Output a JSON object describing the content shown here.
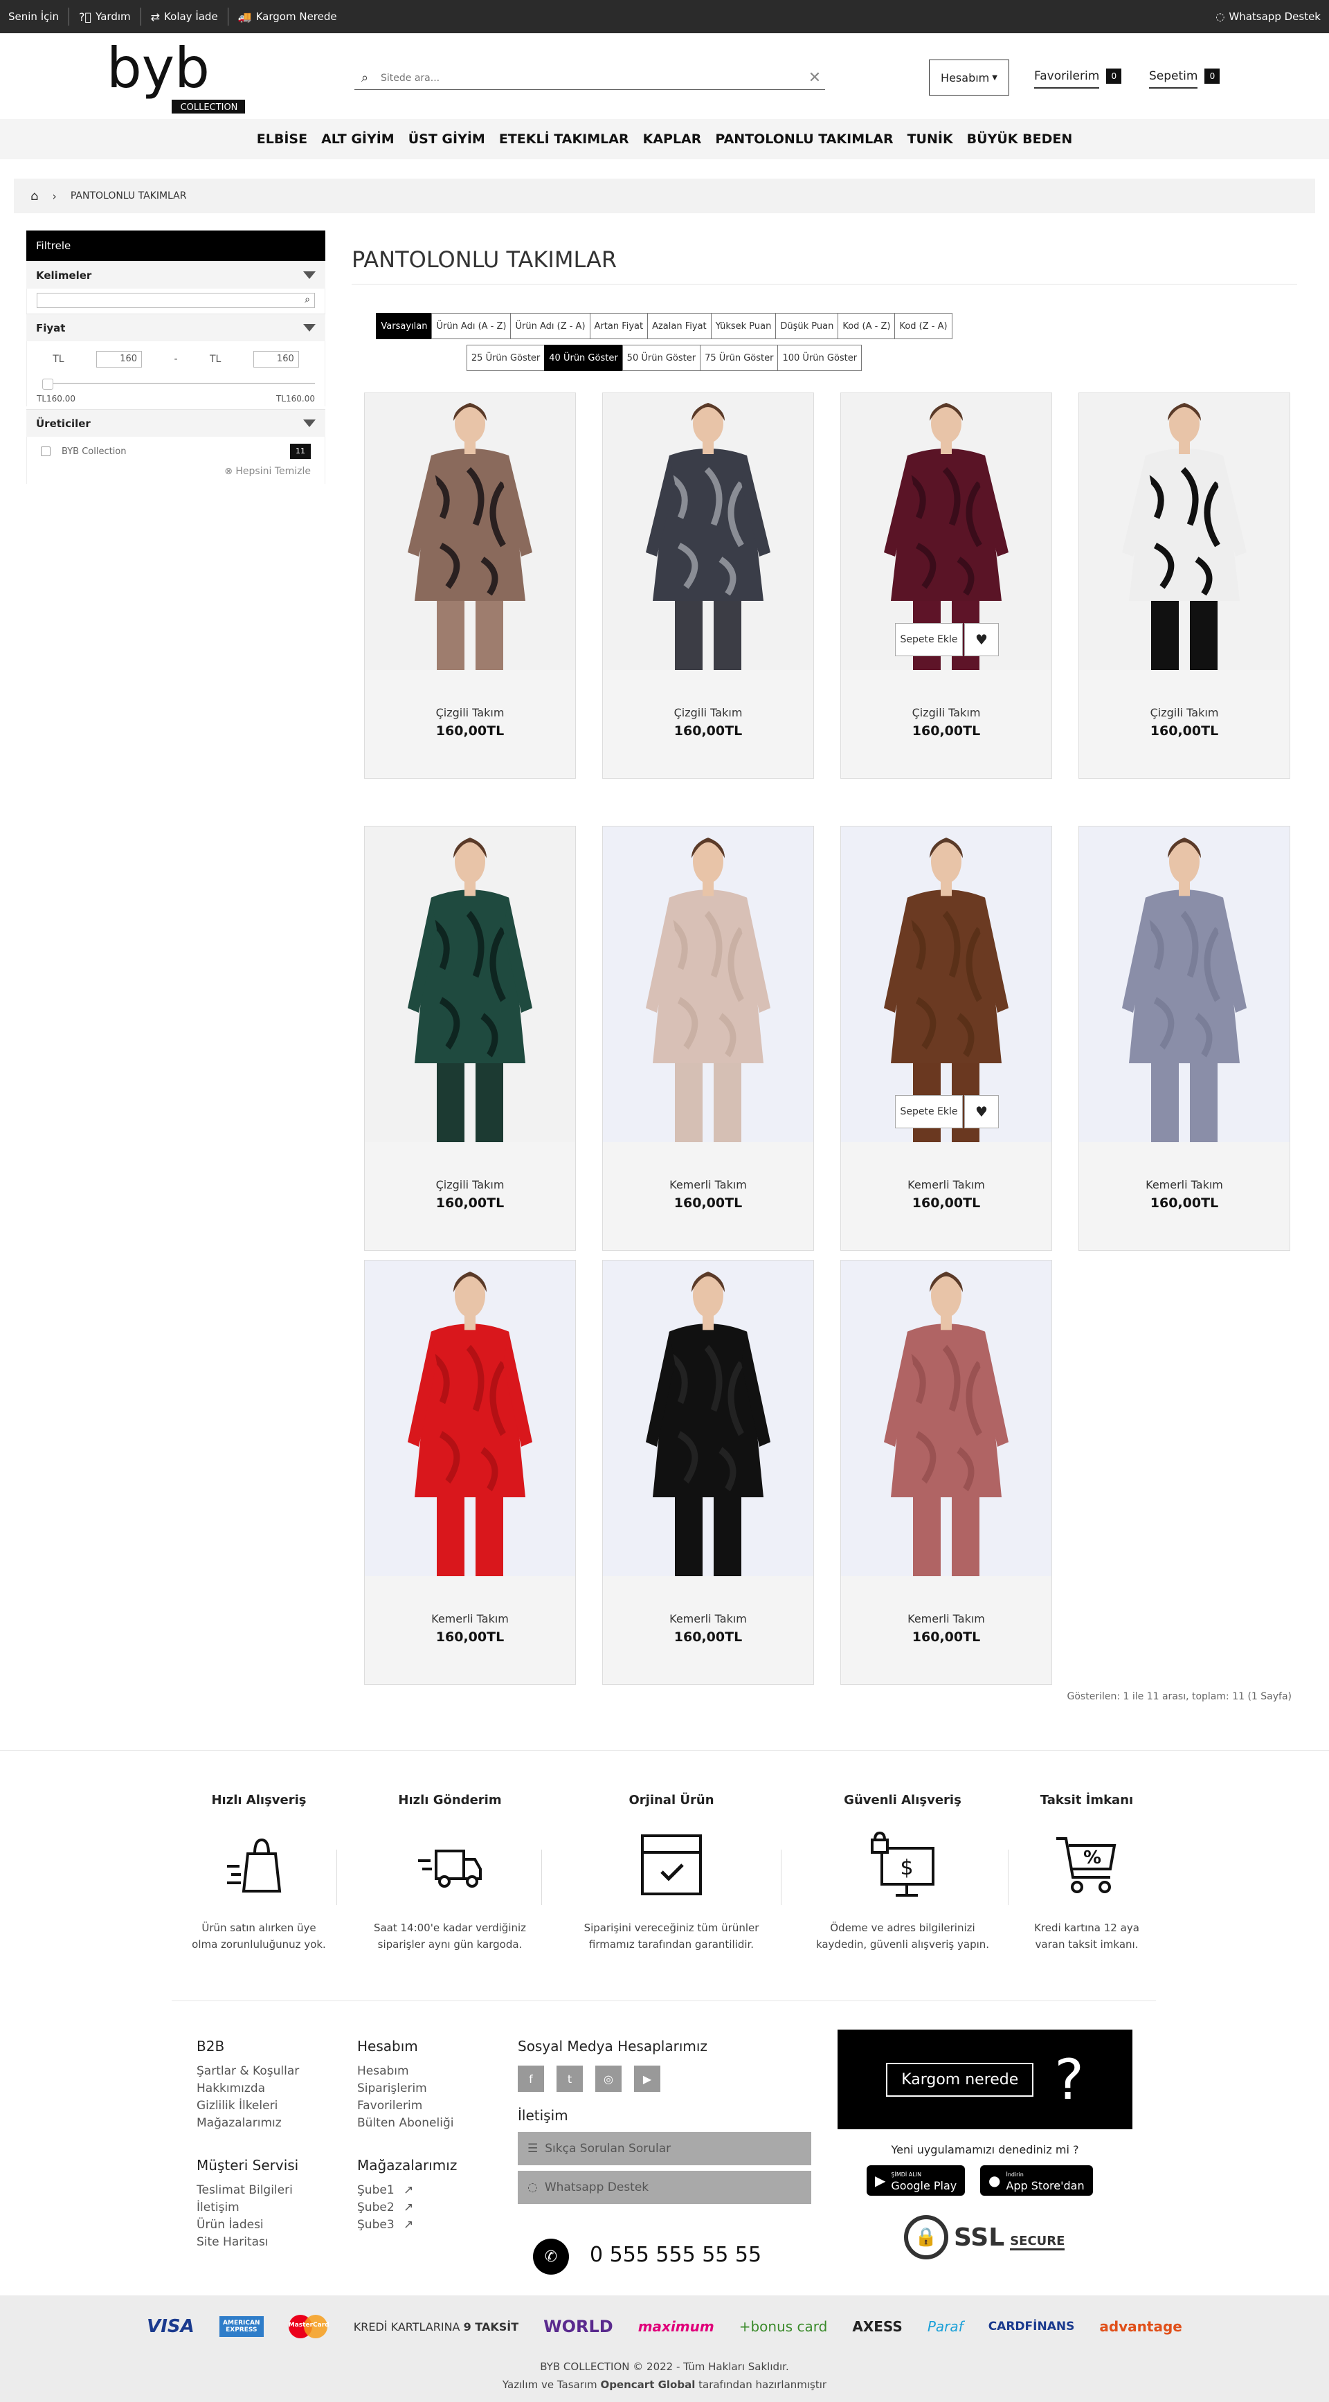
{
  "topbar": {
    "senin_icin": "Senin İçin",
    "yardim": "Yardım",
    "kolay_iade": "Kolay İade",
    "kargom_nerede": "Kargom Nerede",
    "whatsapp": "Whatsapp Destek"
  },
  "header": {
    "logo_main": "byb",
    "logo_sub": "COLLECTION",
    "search_placeholder": "Sitede ara...",
    "account": "Hesabım",
    "favorites": "Favorilerim",
    "favorites_count": "0",
    "cart": "Sepetim",
    "cart_count": "0"
  },
  "menu": [
    "ELBİSE",
    "ALT GİYİM",
    "ÜST GİYİM",
    "ETEKLİ TAKIMLAR",
    "KAPLAR",
    "PANTOLONLU TAKIMLAR",
    "TUNİK",
    "BÜYÜK BEDEN"
  ],
  "breadcrumb": {
    "current": "PANTOLONLU TAKIMLAR"
  },
  "sidebar": {
    "title": "Filtrele",
    "keywords": "Kelimeler",
    "price": "Fiyat",
    "price_cur": "TL",
    "price_min": "160",
    "price_max": "160",
    "price_sep": "-",
    "range_min": "TL160.00",
    "range_max": "TL160.00",
    "manufacturers": "Üreticiler",
    "manufacturer_name": "BYB Collection",
    "manufacturer_count": "11",
    "clear_all": "Hepsini Temizle"
  },
  "page_title": "PANTOLONLU TAKIMLAR",
  "sort_options": [
    "Varsayılan",
    "Ürün Adı (A - Z)",
    "Ürün Adı (Z - A)",
    "Artan Fiyat",
    "Azalan Fiyat",
    "Yüksek Puan",
    "Düşük Puan",
    "Kod (A - Z)",
    "Kod (Z - A)"
  ],
  "sort_active": 0,
  "limit_options": [
    "25 Ürün Göster",
    "40 Ürün Göster",
    "50 Ürün Göster",
    "75 Ürün Göster",
    "100 Ürün Göster"
  ],
  "limit_active": 1,
  "add_to_cart": "Sepete Ekle",
  "products": [
    {
      "name": "Çizgili Takım",
      "price": "160,00TL",
      "top": "#8a6a5c",
      "pattern": "#2a2020",
      "bottom": "#9e7d6e",
      "bg": "#f2f2f2"
    },
    {
      "name": "Çizgili Takım",
      "price": "160,00TL",
      "top": "#3a3d48",
      "pattern": "#8a8d95",
      "bottom": "#3c3d45",
      "bg": "#f2f2f2"
    },
    {
      "name": "Çizgili Takım",
      "price": "160,00TL",
      "top": "#5a1426",
      "pattern": "#3a0c1a",
      "bottom": "#5e1428",
      "bg": "#f2f2f2"
    },
    {
      "name": "Çizgili Takım",
      "price": "160,00TL",
      "top": "#eeeeee",
      "pattern": "#111111",
      "bottom": "#111111",
      "bg": "#f2f2f2"
    },
    {
      "name": "Çizgili Takım",
      "price": "160,00TL",
      "top": "#1f4a3f",
      "pattern": "#0e2520",
      "bottom": "#1c3a32",
      "bg": "#f2f2f2"
    },
    {
      "name": "Kemerli Takım",
      "price": "160,00TL",
      "top": "#d8c0b6",
      "pattern": "#c9b0a4",
      "bottom": "#d5bfb4",
      "bg": "#eef0f8"
    },
    {
      "name": "Kemerli Takım",
      "price": "160,00TL",
      "top": "#6b3a22",
      "pattern": "#5a3018",
      "bottom": "#6a3820",
      "bg": "#eef0f8"
    },
    {
      "name": "Kemerli Takım",
      "price": "160,00TL",
      "top": "#8a8ea8",
      "pattern": "#7a7e98",
      "bottom": "#8a8ea8",
      "bg": "#eef0f8"
    },
    {
      "name": "Kemerli Takım",
      "price": "160,00TL",
      "top": "#d9171c",
      "pattern": "#b41014",
      "bottom": "#d9171c",
      "bg": "#eef0f8"
    },
    {
      "name": "Kemerli Takım",
      "price": "160,00TL",
      "top": "#111111",
      "pattern": "#222222",
      "bottom": "#111111",
      "bg": "#eef0f8"
    },
    {
      "name": "Kemerli Takım",
      "price": "160,00TL",
      "top": "#b06464",
      "pattern": "#9a5252",
      "bottom": "#b06464",
      "bg": "#eef0f8"
    }
  ],
  "shown_text": "Gösterilen: 1 ile 11 arası, toplam: 11 (1 Sayfa)",
  "features": [
    {
      "title": "Hızlı Alışveriş",
      "desc1": "Ürün satın alırken üye",
      "desc2": "olma zorunluluğunuz yok.",
      "icon": "shopping-bag-icon"
    },
    {
      "title": "Hızlı Gönderim",
      "desc1": "Saat 14:00'e kadar verdiğiniz",
      "desc2": "siparişler aynı gün kargoda.",
      "icon": "truck-icon"
    },
    {
      "title": "Orjinal Ürün",
      "desc1": "Siparişini vereceğiniz tüm ürünler",
      "desc2": "firmamız tarafından garantilidir.",
      "icon": "box-check-icon"
    },
    {
      "title": "Güvenli Alışveriş",
      "desc1": "Ödeme ve adres bilgilerinizi",
      "desc2": "kaydedin, güvenli alışveriş yapın.",
      "icon": "secure-monitor-icon"
    },
    {
      "title": "Taksit İmkanı",
      "desc1": "Kredi kartına 12 aya",
      "desc2": "varan taksit imkanı.",
      "icon": "percent-cart-icon"
    }
  ],
  "footer": {
    "b2b_title": "B2B",
    "b2b_links": [
      "Şartlar & Koşullar",
      "Hakkımızda",
      "Gizlilik İlkeleri",
      "Mağazalarımız"
    ],
    "account_title": "Hesabım",
    "account_links": [
      "Hesabım",
      "Siparişlerim",
      "Favorilerim",
      "Bülten Aboneliği"
    ],
    "customer_title": "Müşteri Servisi",
    "customer_links": [
      "Teslimat Bilgileri",
      "İletişim",
      "Ürün İadesi",
      "Site Haritası"
    ],
    "stores_title": "Mağazalarımız",
    "stores_links": [
      "Şube1",
      "Şube2",
      "Şube3"
    ],
    "social_title": "Sosyal Medya Hesaplarımız",
    "contact_title": "İletişim",
    "faq": "Sıkça Sorulan Sorular",
    "whatsapp": "Whatsapp Destek",
    "phone": "0 555 555 55 55",
    "kargom": "Kargom nerede",
    "kargom_q": "?",
    "app_question": "Yeni uygulamamızı denediniz mi ?",
    "google_play_small": "ŞİMDİ ALIN",
    "google_play": "Google Play",
    "app_store_small": "İndirin",
    "app_store": "App Store'dan",
    "ssl": "SSL",
    "ssl_secure": "SECURE"
  },
  "payments": [
    "VISA",
    "AMERICAN EXPRESS",
    "MasterCard",
    "KREDİ KARTLARINA",
    "9 TAKSİT",
    "WORLD",
    "maximum",
    "+bonus card",
    "AXESS",
    "Paraf",
    "CARDFİNANS",
    "advantage"
  ],
  "copyright": "BYB COLLECTION © 2022 - Tüm Hakları Saklıdır.",
  "credit_prefix": "Yazılım ve Tasarım",
  "credit_brand": "Opencart Global",
  "credit_suffix": "tarafından hazırlanmıştır"
}
